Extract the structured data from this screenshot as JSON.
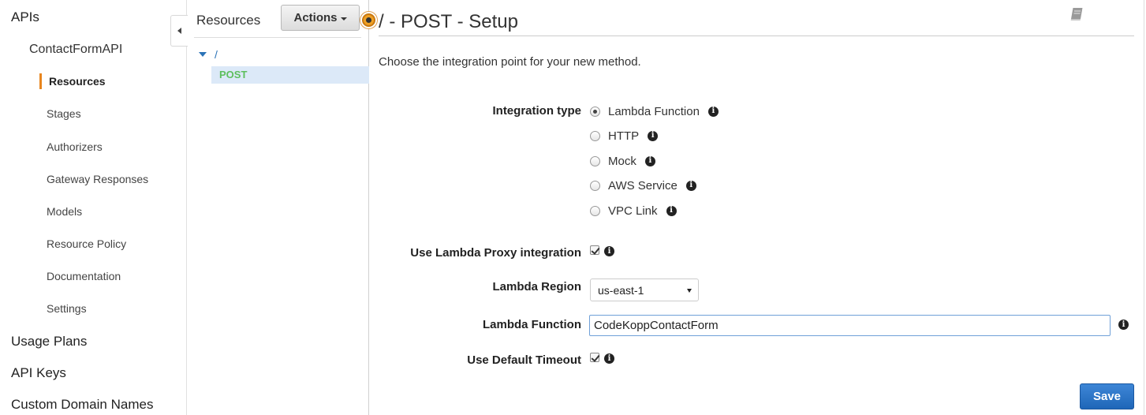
{
  "nav": {
    "apis": "APIs",
    "api_name": "ContactFormAPI",
    "items": [
      {
        "label": "Resources",
        "active": true
      },
      {
        "label": "Stages"
      },
      {
        "label": "Authorizers"
      },
      {
        "label": "Gateway Responses"
      },
      {
        "label": "Models"
      },
      {
        "label": "Resource Policy"
      },
      {
        "label": "Documentation"
      },
      {
        "label": "Settings"
      }
    ],
    "usage_plans": "Usage Plans",
    "api_keys": "API Keys",
    "custom_domains": "Custom Domain Names"
  },
  "resources": {
    "title": "Resources",
    "actions_label": "Actions",
    "root_path": "/",
    "method": "POST"
  },
  "main": {
    "title": "/ - POST - Setup",
    "intro": "Choose the integration point for your new method.",
    "integration_type_label": "Integration type",
    "integration_types": [
      {
        "label": "Lambda Function",
        "checked": true
      },
      {
        "label": "HTTP",
        "checked": false
      },
      {
        "label": "Mock",
        "checked": false
      },
      {
        "label": "AWS Service",
        "checked": false
      },
      {
        "label": "VPC Link",
        "checked": false
      }
    ],
    "proxy_label": "Use Lambda Proxy integration",
    "proxy_checked": true,
    "region_label": "Lambda Region",
    "region_value": "us-east-1",
    "function_label": "Lambda Function",
    "function_value": "CodeKoppContactForm",
    "timeout_label": "Use Default Timeout",
    "timeout_checked": true,
    "save_label": "Save"
  },
  "icons": {
    "info": "i",
    "book": "book-icon"
  },
  "colors": {
    "accent_orange": "#e8861f",
    "link_blue": "#2b73b7",
    "method_green": "#5dbf5d",
    "primary_button": "#2a74c8"
  }
}
